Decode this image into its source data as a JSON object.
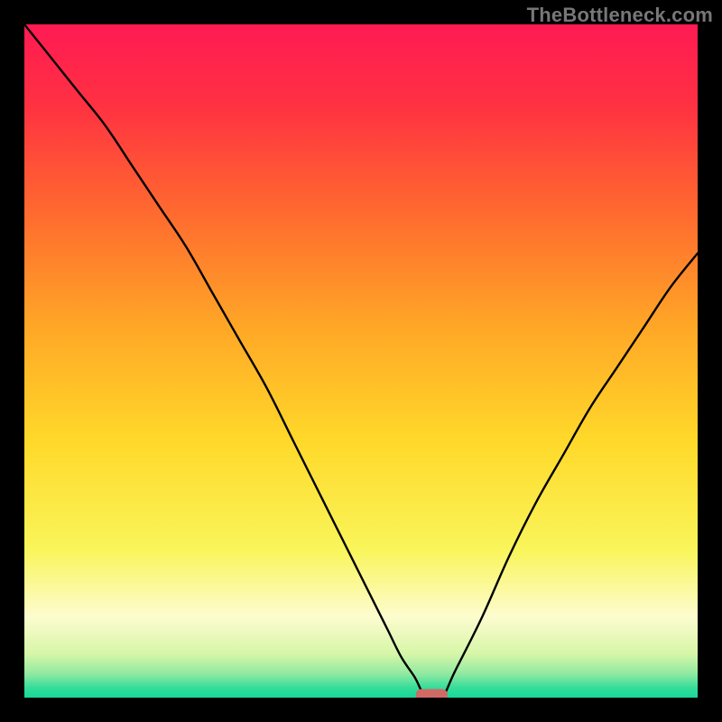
{
  "watermark": "TheBottleneck.com",
  "colors": {
    "frame": "#000000",
    "watermark_text": "#777777",
    "curve": "#000000",
    "marker": "#cf6a65",
    "gradient_stops": [
      {
        "offset": 0.0,
        "color": "#ff1a53"
      },
      {
        "offset": 0.12,
        "color": "#ff3142"
      },
      {
        "offset": 0.28,
        "color": "#ff6a2f"
      },
      {
        "offset": 0.45,
        "color": "#ffa726"
      },
      {
        "offset": 0.62,
        "color": "#ffd92a"
      },
      {
        "offset": 0.78,
        "color": "#f9f55a"
      },
      {
        "offset": 0.88,
        "color": "#fdfccf"
      },
      {
        "offset": 0.935,
        "color": "#d6f6a8"
      },
      {
        "offset": 0.965,
        "color": "#8fe9a1"
      },
      {
        "offset": 0.985,
        "color": "#35dd9a"
      },
      {
        "offset": 1.0,
        "color": "#17d89a"
      }
    ]
  },
  "chart_data": {
    "type": "line",
    "title": "",
    "xlabel": "",
    "ylabel": "",
    "xlim": [
      0,
      100
    ],
    "ylim": [
      0,
      100
    ],
    "grid": false,
    "legend": false,
    "series": [
      {
        "name": "bottleneck-curve",
        "x": [
          0,
          4,
          8,
          12,
          16,
          20,
          24,
          28,
          32,
          36,
          40,
          44,
          48,
          52,
          54,
          56,
          58,
          59,
          60,
          62,
          64,
          68,
          72,
          76,
          80,
          84,
          88,
          92,
          96,
          100
        ],
        "values": [
          100,
          95,
          90,
          85,
          79,
          73,
          67,
          60,
          53,
          46,
          38,
          30,
          22,
          14,
          10,
          6,
          3,
          1,
          0,
          0,
          4,
          12,
          21,
          29,
          36,
          43,
          49,
          55,
          61,
          66
        ]
      }
    ],
    "marker": {
      "x": 60.5,
      "y": 0,
      "width_pct": 4.7,
      "height_pct": 2.0
    },
    "background_gradient": "vertical red→orange→yellow→pale→green"
  }
}
